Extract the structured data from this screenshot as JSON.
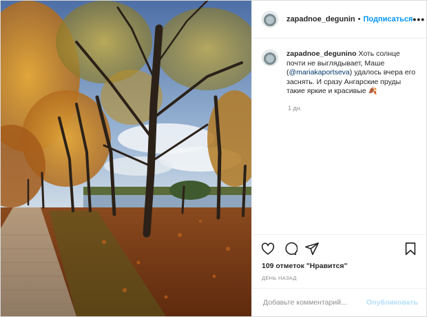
{
  "post": {
    "username": "zapadnoe_degunin",
    "separator": "•",
    "follow_label": "Подписаться",
    "more_label": "•••",
    "caption": {
      "username": "zapadnoe_degunino",
      "text_before": " Хоть солнце почти не выглядывает, Маше (",
      "mention": "@mariakaportseva",
      "text_after": ") удалось вчера его заснять. И сразу Ангарские пруды такие яркие и красивые 🍂"
    },
    "time": "1 дн.",
    "likes": "109 отметок \"Нравится\"",
    "posted": "ДЕНЬ НАЗАД",
    "comment_placeholder": "Добавьте комментарий...",
    "publish_label": "Опубликовать"
  },
  "icons": {
    "like": "heart-icon",
    "comment": "comment-icon",
    "share": "share-icon",
    "save": "bookmark-icon",
    "more": "more-icon"
  },
  "colors": {
    "link_blue": "#0095f6",
    "publish_disabled": "#b2dffc",
    "mention": "#00376b",
    "muted": "#8e8e8e"
  }
}
